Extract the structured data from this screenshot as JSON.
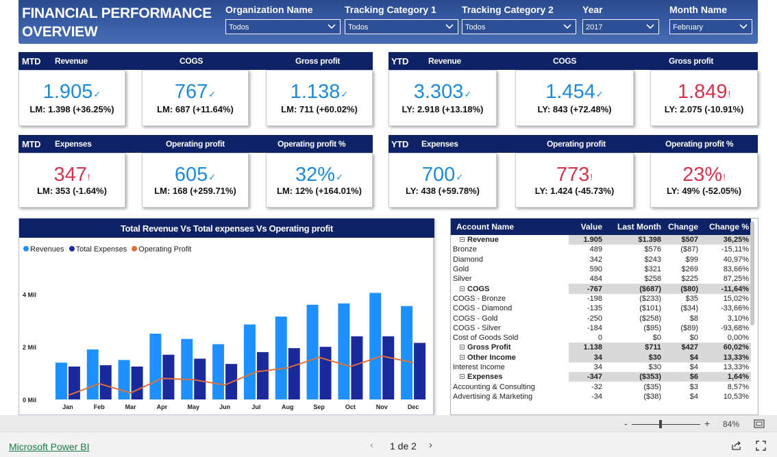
{
  "header": {
    "title": "FINANCIAL PERFORMANCE OVERVIEW",
    "slicers": [
      {
        "label": "Organization Name",
        "value": "Todos"
      },
      {
        "label": "Tracking Category 1",
        "value": "Todos"
      },
      {
        "label": "Tracking Category 2",
        "value": "Todos"
      },
      {
        "label": "Year",
        "value": "2017"
      },
      {
        "label": "Month Name",
        "value": "February"
      }
    ]
  },
  "sections": {
    "mtd": "MTD",
    "ytd": "YTD",
    "revenue": "Revenue",
    "cogs": "COGS",
    "gross_profit": "Gross profit",
    "expenses": "Expenses",
    "operating_profit": "Operating profit",
    "operating_profit_pct": "Operating profit %"
  },
  "status_marks": {
    "up": "✓",
    "down": "!"
  },
  "colors": {
    "header_bg": "#2c4f96",
    "bar_bg": "#0e2266",
    "positive": "#1c8ad8",
    "negative": "#d0344e",
    "revenues": "#1e90ff",
    "expenses": "#1a2a9a",
    "op_profit": "#e0703a"
  },
  "kpis": {
    "mtd_revenue": {
      "value": "1.905",
      "compare": "LM: 1.398 (+36.25%)",
      "status": "positive"
    },
    "mtd_cogs": {
      "value": "767",
      "compare": "LM: 687 (+11.64%)",
      "status": "positive"
    },
    "mtd_gross": {
      "value": "1.138",
      "compare": "LM: 711 (+60.02%)",
      "status": "positive"
    },
    "ytd_revenue": {
      "value": "3.303",
      "compare": "LY: 2.918 (+13.18%)",
      "status": "positive"
    },
    "ytd_cogs": {
      "value": "1.454",
      "compare": "LY: 843 (+72.48%)",
      "status": "positive"
    },
    "ytd_gross": {
      "value": "1.849",
      "compare": "LY: 2.075 (-10.91%)",
      "status": "negative"
    },
    "mtd_expenses": {
      "value": "347",
      "compare": "LM: 353 (-1.64%)",
      "status": "negative"
    },
    "mtd_opprofit": {
      "value": "605",
      "compare": "LM: 168 (+259.71%)",
      "status": "positive"
    },
    "mtd_oppct": {
      "value": "32%",
      "compare": "LM: 12% (+164.01%)",
      "status": "positive"
    },
    "ytd_expenses": {
      "value": "700",
      "compare": "LY: 438 (+59.78%)",
      "status": "positive"
    },
    "ytd_opprofit": {
      "value": "773",
      "compare": "LY: 1.424 (-45.73%)",
      "status": "negative"
    },
    "ytd_oppct": {
      "value": "23%",
      "compare": "LY: 49% (-52.05%)",
      "status": "negative"
    }
  },
  "chart_data": {
    "type": "bar",
    "title": "Total Revenue Vs Total expenses  Vs  Operating profit",
    "categories": [
      "Jan",
      "Feb",
      "Mar",
      "Apr",
      "May",
      "Jun",
      "Jul",
      "Aug",
      "Sep",
      "Oct",
      "Nov",
      "Dec"
    ],
    "y_tick_labels": [
      "0 Mil",
      "2 Mil",
      "4 Mil"
    ],
    "y_ticks": [
      0,
      2,
      4
    ],
    "ylim": [
      0,
      5
    ],
    "series": [
      {
        "name": "Revenues",
        "type": "bar",
        "color": "#1e90ff",
        "values": [
          1.4,
          1.9,
          1.5,
          2.5,
          2.3,
          2.1,
          2.85,
          3.15,
          3.6,
          3.65,
          4.05,
          3.55
        ]
      },
      {
        "name": "Total Expenses",
        "type": "bar",
        "color": "#1a2a9a",
        "values": [
          1.25,
          1.3,
          1.25,
          1.7,
          1.55,
          1.35,
          1.8,
          1.95,
          2.0,
          2.4,
          2.4,
          2.15
        ]
      },
      {
        "name": "Operating Profit",
        "type": "line",
        "color": "#e0703a",
        "values": [
          0.15,
          0.6,
          0.25,
          0.8,
          0.75,
          0.55,
          1.05,
          1.2,
          1.6,
          1.25,
          1.65,
          1.4
        ]
      }
    ],
    "legend_position": "top-left",
    "grid": false
  },
  "matrix": {
    "columns": [
      "Account Name",
      "Value",
      "Last Month",
      "Change",
      "Change %"
    ],
    "rows": [
      {
        "type": "group",
        "cells": [
          "Revenue",
          "1.905",
          "$1.398",
          "$507",
          "36,25%"
        ]
      },
      {
        "type": "child",
        "cells": [
          "Bronze",
          "489",
          "$576",
          "($87)",
          "-15,11%"
        ]
      },
      {
        "type": "child",
        "cells": [
          "Diamond",
          "342",
          "$243",
          "$99",
          "40,97%"
        ]
      },
      {
        "type": "child",
        "cells": [
          "Gold",
          "590",
          "$321",
          "$269",
          "83,66%"
        ]
      },
      {
        "type": "child",
        "cells": [
          "Silver",
          "484",
          "$258",
          "$225",
          "87,25%"
        ]
      },
      {
        "type": "group",
        "cells": [
          "COGS",
          "-767",
          "($687)",
          "($80)",
          "-11,64%"
        ]
      },
      {
        "type": "child",
        "cells": [
          "COGS - Bronze",
          "-198",
          "($233)",
          "$35",
          "15,02%"
        ]
      },
      {
        "type": "child",
        "cells": [
          "COGS - Diamond",
          "-135",
          "($101)",
          "($34)",
          "-33,66%"
        ]
      },
      {
        "type": "child",
        "cells": [
          "COGS - Gold",
          "-250",
          "($258)",
          "$8",
          "3,10%"
        ]
      },
      {
        "type": "child",
        "cells": [
          "COGS - Silver",
          "-184",
          "($95)",
          "($89)",
          "-93,68%"
        ]
      },
      {
        "type": "child",
        "cells": [
          "Cost of Goods Sold",
          "0",
          "$0",
          "$0",
          "0,00%"
        ]
      },
      {
        "type": "group",
        "cells": [
          "Gross Profit",
          "1.138",
          "$711",
          "$427",
          "60,02%"
        ]
      },
      {
        "type": "group",
        "cells": [
          "Other Income",
          "34",
          "$30",
          "$4",
          "13,33%"
        ]
      },
      {
        "type": "child",
        "cells": [
          "Interest Income",
          "34",
          "$30",
          "$4",
          "13,33%"
        ]
      },
      {
        "type": "group",
        "cells": [
          "Expenses",
          "-347",
          "($353)",
          "$6",
          "1,64%"
        ]
      },
      {
        "type": "child",
        "cells": [
          "Accounting & Consulting",
          "-32",
          "($35)",
          "$3",
          "8,57%"
        ]
      },
      {
        "type": "child",
        "cells": [
          "Advertising & Marketing",
          "-34",
          "($38)",
          "$4",
          "10,53%"
        ]
      }
    ]
  },
  "zoombar": {
    "minus": "-",
    "plus": "+",
    "zoom": "84%"
  },
  "footer": {
    "brand": "Microsoft Power BI",
    "page": "1 de 2",
    "prev": "‹",
    "next": "›"
  }
}
